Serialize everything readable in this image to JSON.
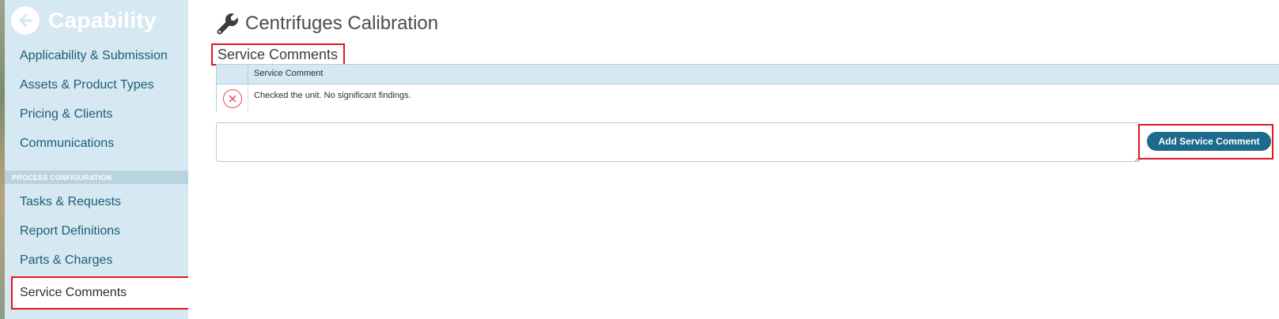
{
  "colors": {
    "accent": "#1d6a8c",
    "sidebar_bg": "#d6e8f1",
    "highlight": "#e0191b",
    "delete": "#e24c5a"
  },
  "sidebar": {
    "title": "Capability",
    "back_icon": "arrow-left-circle-icon",
    "items": [
      {
        "label": "Applicability & Submission"
      },
      {
        "label": "Assets & Product Types"
      },
      {
        "label": "Pricing & Clients"
      },
      {
        "label": "Communications"
      }
    ],
    "section_label": "PROCESS CONFIGURATION",
    "section_items": [
      {
        "label": "Tasks & Requests"
      },
      {
        "label": "Report Definitions"
      },
      {
        "label": "Parts & Charges"
      },
      {
        "label": "Service Comments",
        "active": true
      }
    ]
  },
  "main": {
    "title_icon": "wrench-icon",
    "title": "Centrifuges Calibration",
    "section_title": "Service Comments",
    "table": {
      "columns": [
        "Service Comment"
      ],
      "rows": [
        {
          "comment": "Checked the unit. No significant findings.",
          "action_icon": "delete-x-icon"
        }
      ]
    },
    "input": {
      "value": "",
      "placeholder": ""
    },
    "add_button_label": "Add Service Comment"
  }
}
